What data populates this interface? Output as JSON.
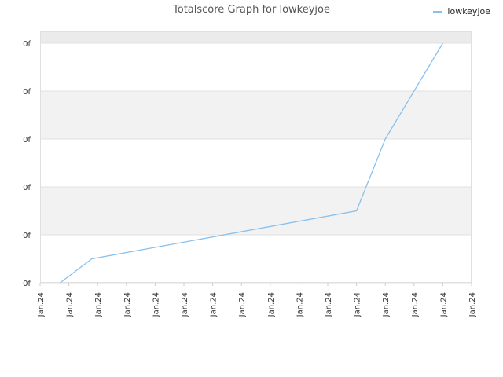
{
  "chart_data": {
    "type": "line",
    "title": "Totalscore Graph for lowkeyjoe",
    "xlabel": "",
    "ylabel": "",
    "x_ticks": [
      "Jan.24",
      "Jan.24",
      "Jan.24",
      "Jan.24",
      "Jan.24",
      "Jan.24",
      "Jan.24",
      "Jan.24",
      "Jan.24",
      "Jan.24",
      "Jan.24",
      "Jan.24",
      "Jan.24",
      "Jan.24",
      "Jan.24",
      "Jan.24"
    ],
    "y_ticks": [
      "0f",
      "0f",
      "0f",
      "0f",
      "0f",
      "0f"
    ],
    "ylim": [
      0,
      5
    ],
    "xlim": [
      0,
      15
    ],
    "grid": true,
    "legend": "top-right",
    "series": [
      {
        "name": "lowkeyjoe",
        "color": "#88c1ed",
        "x": [
          0.7,
          1.8,
          11.0,
          12.0,
          14.0
        ],
        "y": [
          0.0,
          0.5,
          1.5,
          3.0,
          5.0
        ]
      }
    ]
  },
  "colors": {
    "band": "#f2f2f2",
    "top_band": "#ebebeb",
    "gridline": "#e0e0e0",
    "axis": "#cccccc",
    "tick_text": "#333333"
  }
}
